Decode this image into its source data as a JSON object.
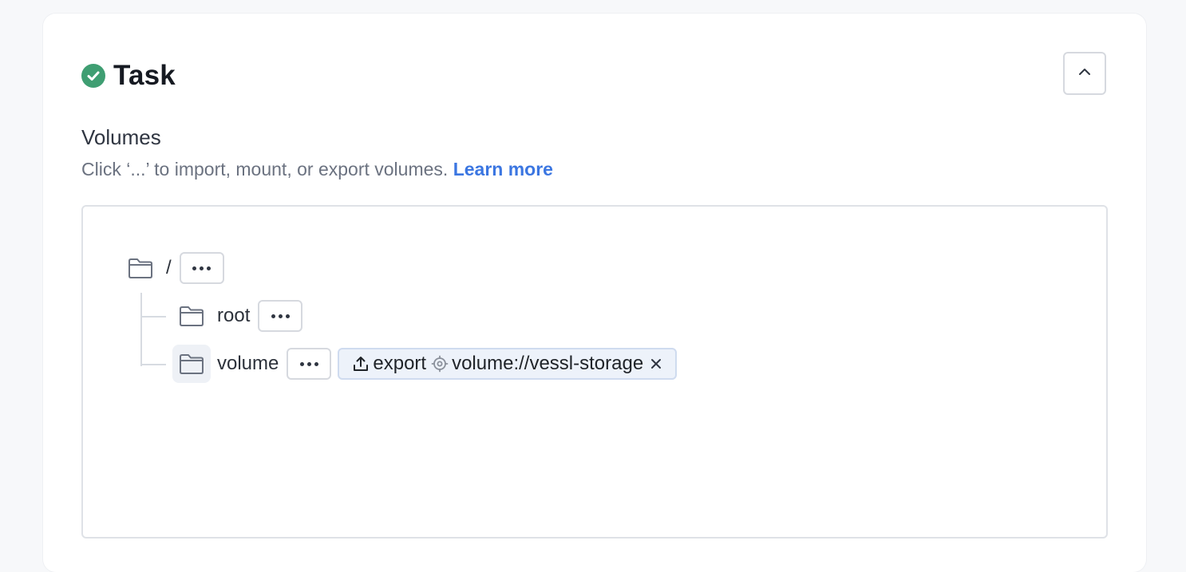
{
  "task": {
    "title": "Task",
    "status_icon": "check-circle-icon",
    "status_color": "#3f9e72",
    "collapse_icon": "chevron-up-icon"
  },
  "volumes": {
    "title": "Volumes",
    "description": "Click ‘...’ to import, mount, or export volumes.",
    "learn_more": "Learn more",
    "tree": {
      "root": {
        "label": "/",
        "icon": "folder-icon",
        "more_icon": "more-horizontal-icon"
      },
      "children": [
        {
          "label": "root",
          "icon": "folder-icon",
          "more_icon": "more-horizontal-icon"
        },
        {
          "label": "volume",
          "icon": "folder-icon",
          "more_icon": "more-horizontal-icon",
          "selected": true,
          "tag": {
            "action_icon": "upload-icon",
            "action": "export",
            "target_icon": "target-icon",
            "target": "volume://vessl-storage",
            "remove_icon": "close-icon"
          }
        }
      ]
    }
  },
  "colors": {
    "accent_link": "#3b76e1",
    "tag_bg": "#edf2fa"
  }
}
